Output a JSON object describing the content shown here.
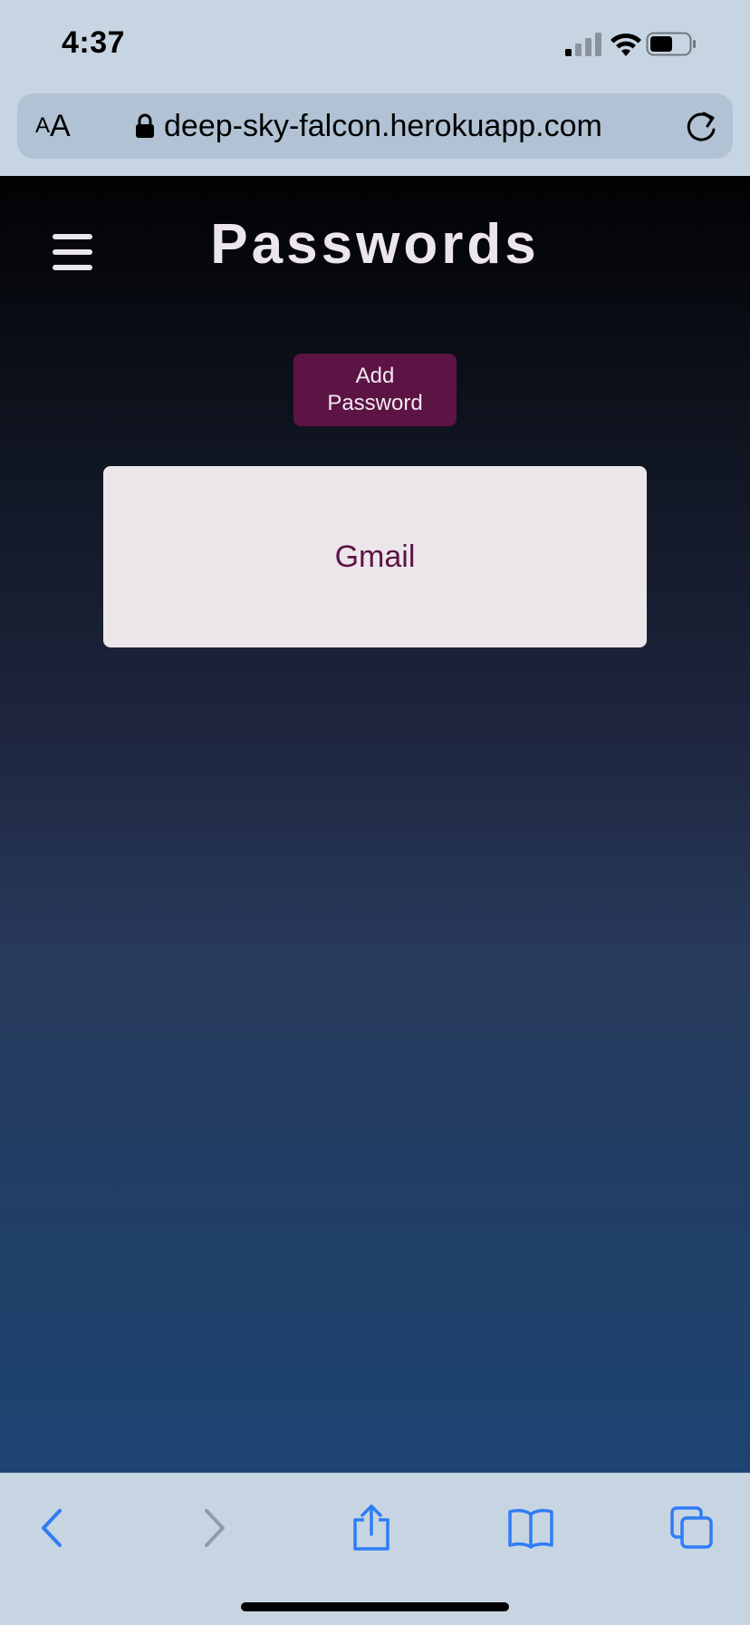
{
  "status_bar": {
    "time": "4:37"
  },
  "browser": {
    "text_size_small": "A",
    "text_size_large": "A",
    "url": "deep-sky-falcon.herokuapp.com"
  },
  "page": {
    "title": "Passwords",
    "add_button_label_line1": "Add",
    "add_button_label_line2": "Password",
    "entries": [
      "Gmail"
    ]
  },
  "colors": {
    "accent": "#5c1445",
    "card_background": "#ece6ea",
    "browser_chrome": "#c7d5e2",
    "ios_blue": "#2f7cf6"
  },
  "icons": {
    "menu": "hamburger-icon",
    "lock": "lock-icon",
    "reload": "reload-icon",
    "back": "chevron-left-icon",
    "forward": "chevron-right-icon",
    "share": "share-icon",
    "bookmarks": "book-icon",
    "tabs": "tabs-icon"
  }
}
